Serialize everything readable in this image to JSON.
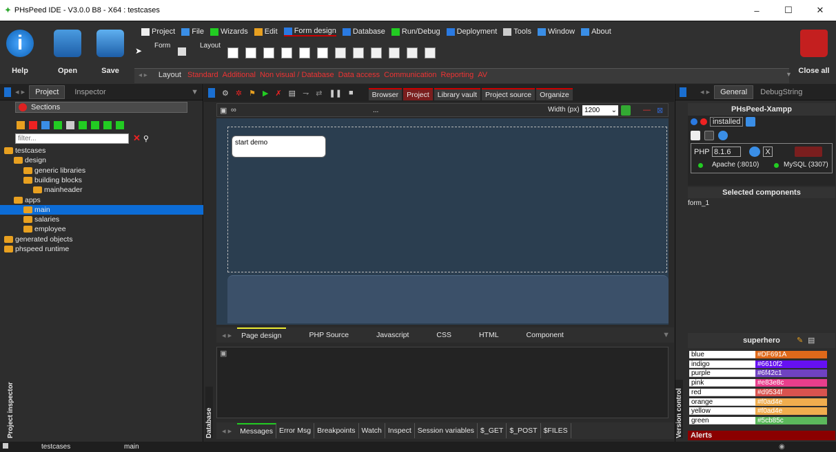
{
  "window": {
    "title": "PHsPeed IDE - V3.0.0 B8 - X64 : testcases",
    "minimize": "–",
    "maximize": "☐",
    "close": "✕"
  },
  "ribbon": {
    "help": "Help",
    "open": "Open",
    "save": "Save",
    "close_all": "Close all",
    "form_label": "Form",
    "layout_label": "Layout",
    "menu": [
      "Project",
      "File",
      "Wizards",
      "Edit",
      "Form design",
      "Database",
      "Run/Debug",
      "Deployment",
      "Tools",
      "Window",
      "About"
    ],
    "tab_layout": "Layout",
    "tabs": [
      "Standard",
      "Additional",
      "Non visual / Database",
      "Data access",
      "Communication",
      "Reporting",
      "AV"
    ]
  },
  "left_panel": {
    "tab_project": "Project",
    "tab_inspector": "Inspector",
    "sections": "Sections",
    "filter_placeholder": "filter...",
    "tree": [
      {
        "label": "testcases",
        "level": 0,
        "selected": false
      },
      {
        "label": "design",
        "level": 1,
        "selected": false
      },
      {
        "label": "generic libraries",
        "level": 2,
        "selected": false
      },
      {
        "label": "building blocks",
        "level": 2,
        "selected": false
      },
      {
        "label": "mainheader",
        "level": 3,
        "selected": false
      },
      {
        "label": "apps",
        "level": 1,
        "selected": false
      },
      {
        "label": "main",
        "level": 2,
        "selected": true
      },
      {
        "label": "salaries",
        "level": 2,
        "selected": false
      },
      {
        "label": "employee",
        "level": 2,
        "selected": false
      },
      {
        "label": "generated objects",
        "level": 0,
        "selected": false
      },
      {
        "label": "phspeed runtime",
        "level": 0,
        "selected": false
      }
    ],
    "vertical_label": "Project inspector"
  },
  "center": {
    "view_tabs": [
      "Browser",
      "Project",
      "Library vault",
      "Project source",
      "Organize"
    ],
    "width_label": "Width (px)",
    "width_value": "1200",
    "ellipsis": "...",
    "button_text": "start demo",
    "editor_tabs": [
      "Page design",
      "PHP Source",
      "Javascript",
      "CSS",
      "HTML",
      "Component"
    ],
    "bottom_tabs": [
      "Messages",
      "Error Msg",
      "Breakpoints",
      "Watch",
      "Inspect",
      "Session variables",
      "$_GET",
      "$_POST",
      "$FILES"
    ],
    "database_label": "Database"
  },
  "right_panel": {
    "tab_general": "General",
    "tab_debug": "DebugString",
    "server_title": "PHsPeed-Xampp",
    "installed": "installed",
    "php_label": "PHP",
    "php_version": "8.1.6",
    "x_button": "X",
    "apache": "Apache (:8010)",
    "mysql": "MySQL (3307)",
    "selected_title": "Selected components",
    "selected_item": "form_1",
    "theme_title": "superhero",
    "colors": [
      {
        "name": "blue",
        "value": "#DF691A",
        "hex": "#DF691A"
      },
      {
        "name": "indigo",
        "value": "#6610f2",
        "hex": "#6610f2"
      },
      {
        "name": "purple",
        "value": "#6f42c1",
        "hex": "#6f42c1"
      },
      {
        "name": "pink",
        "value": "#e83e8c",
        "hex": "#e83e8c"
      },
      {
        "name": "red",
        "value": "#d9534f",
        "hex": "#d9534f"
      },
      {
        "name": "orange",
        "value": "#f0ad4e",
        "hex": "#f0ad4e"
      },
      {
        "name": "yellow",
        "value": "#f0ad4e",
        "hex": "#f0ad4e"
      },
      {
        "name": "green",
        "value": "#5cb85c",
        "hex": "#5cb85c"
      }
    ],
    "alerts": "Alerts",
    "version_label": "Version control"
  },
  "status": {
    "project": "testcases",
    "form": "main"
  }
}
